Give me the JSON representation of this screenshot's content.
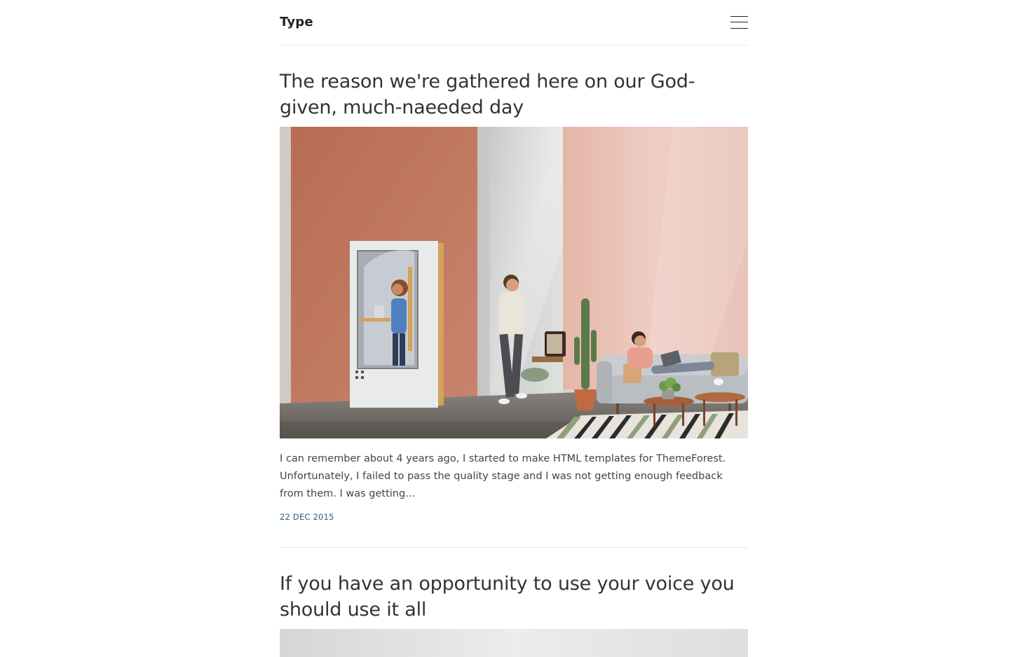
{
  "header": {
    "logo": "Type",
    "menu_icon": "hamburger-menu-icon"
  },
  "posts": [
    {
      "title": "The reason we're gathered here on our God-given, much-naeeded day",
      "image_alt": "Office lounge with phone booth, sofa and cactus",
      "excerpt": "I can remember about 4 years ago, I started to make HTML templates for ThemeForest. Unfortunately, I failed to pass the quality stage and I was not getting enough feedback from them. I was getting...",
      "date": "22 DEC 2015"
    },
    {
      "title": "If you have an opportunity to use your voice you should use it all",
      "image_alt": "Light grey photo"
    }
  ],
  "colors": {
    "text": "#333333",
    "date": "#2e5b7a",
    "divider": "#ebebeb",
    "wall_terracotta": "#c0775f",
    "wall_pink": "#ebc6bc"
  }
}
